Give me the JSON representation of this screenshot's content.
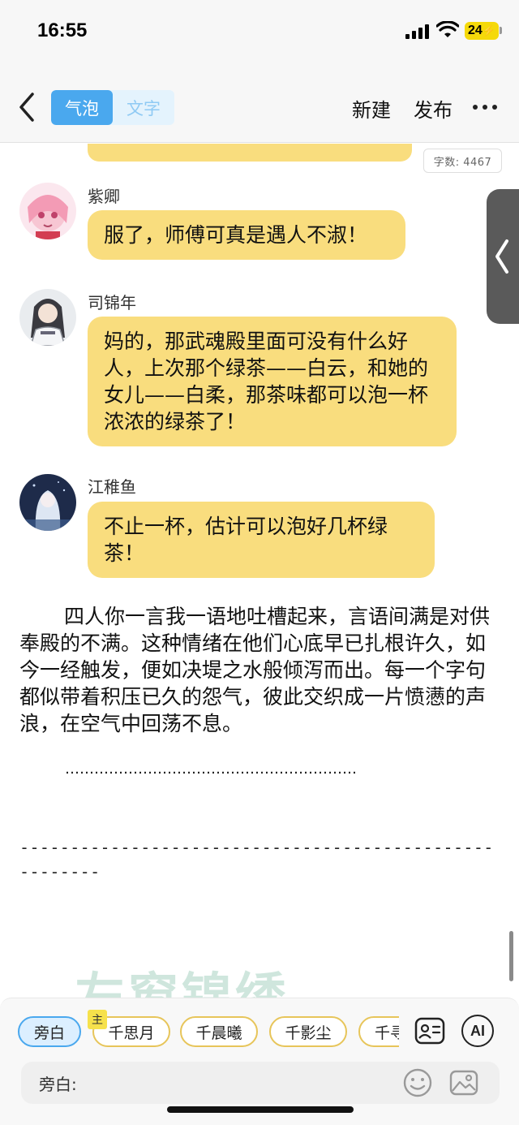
{
  "status_bar": {
    "time": "16:55",
    "battery": "24"
  },
  "nav": {
    "tabs": [
      {
        "label": "气泡",
        "selected": true
      },
      {
        "label": "文字",
        "selected": false
      }
    ],
    "new_label": "新建",
    "publish_label": "发布"
  },
  "word_count": "字数: 4467",
  "messages": [
    {
      "name": "紫卿",
      "text": "服了，师傅可真是遇人不淑！"
    },
    {
      "name": "司锦年",
      "text": "妈的，那武魂殿里面可没有什么好人，上次那个绿茶——白云，和她的女儿——白柔，那茶味都可以泡一杯浓浓的绿茶了！"
    },
    {
      "name": "江稚鱼",
      "text": "不止一杯，估计可以泡好几杯绿茶！"
    }
  ],
  "narration": "四人你一言我一语地吐槽起来，言语间满是对供奉殿的不满。这种情绪在他们心底早已扎根许久，如今一经触发，便如决堤之水般倾泻而出。每一个字句都似带着积压已久的怨气，彼此交织成一片愤懑的声浪，在空气中回荡不息。",
  "dots": "……………………………………………………",
  "dashes": "-------------------------------------------------------",
  "watermark": "左窗锦绣",
  "characters": {
    "main_tag": "主",
    "chips": [
      {
        "label": "旁白",
        "active": true
      },
      {
        "label": "千思月",
        "active": false
      },
      {
        "label": "千晨曦",
        "active": false
      },
      {
        "label": "千影尘",
        "active": false
      },
      {
        "label": "千寻",
        "active": false
      }
    ]
  },
  "ai_label": "AI",
  "input": {
    "label": "旁白:"
  },
  "colors": {
    "bubble": "#f9dd7e",
    "accent": "#4aa8ee",
    "chip_border": "#e7c55a"
  },
  "icons": [
    "back-icon",
    "more-icon",
    "character-card-icon",
    "emoji-icon",
    "image-icon",
    "side-panel-chevron-icon"
  ]
}
